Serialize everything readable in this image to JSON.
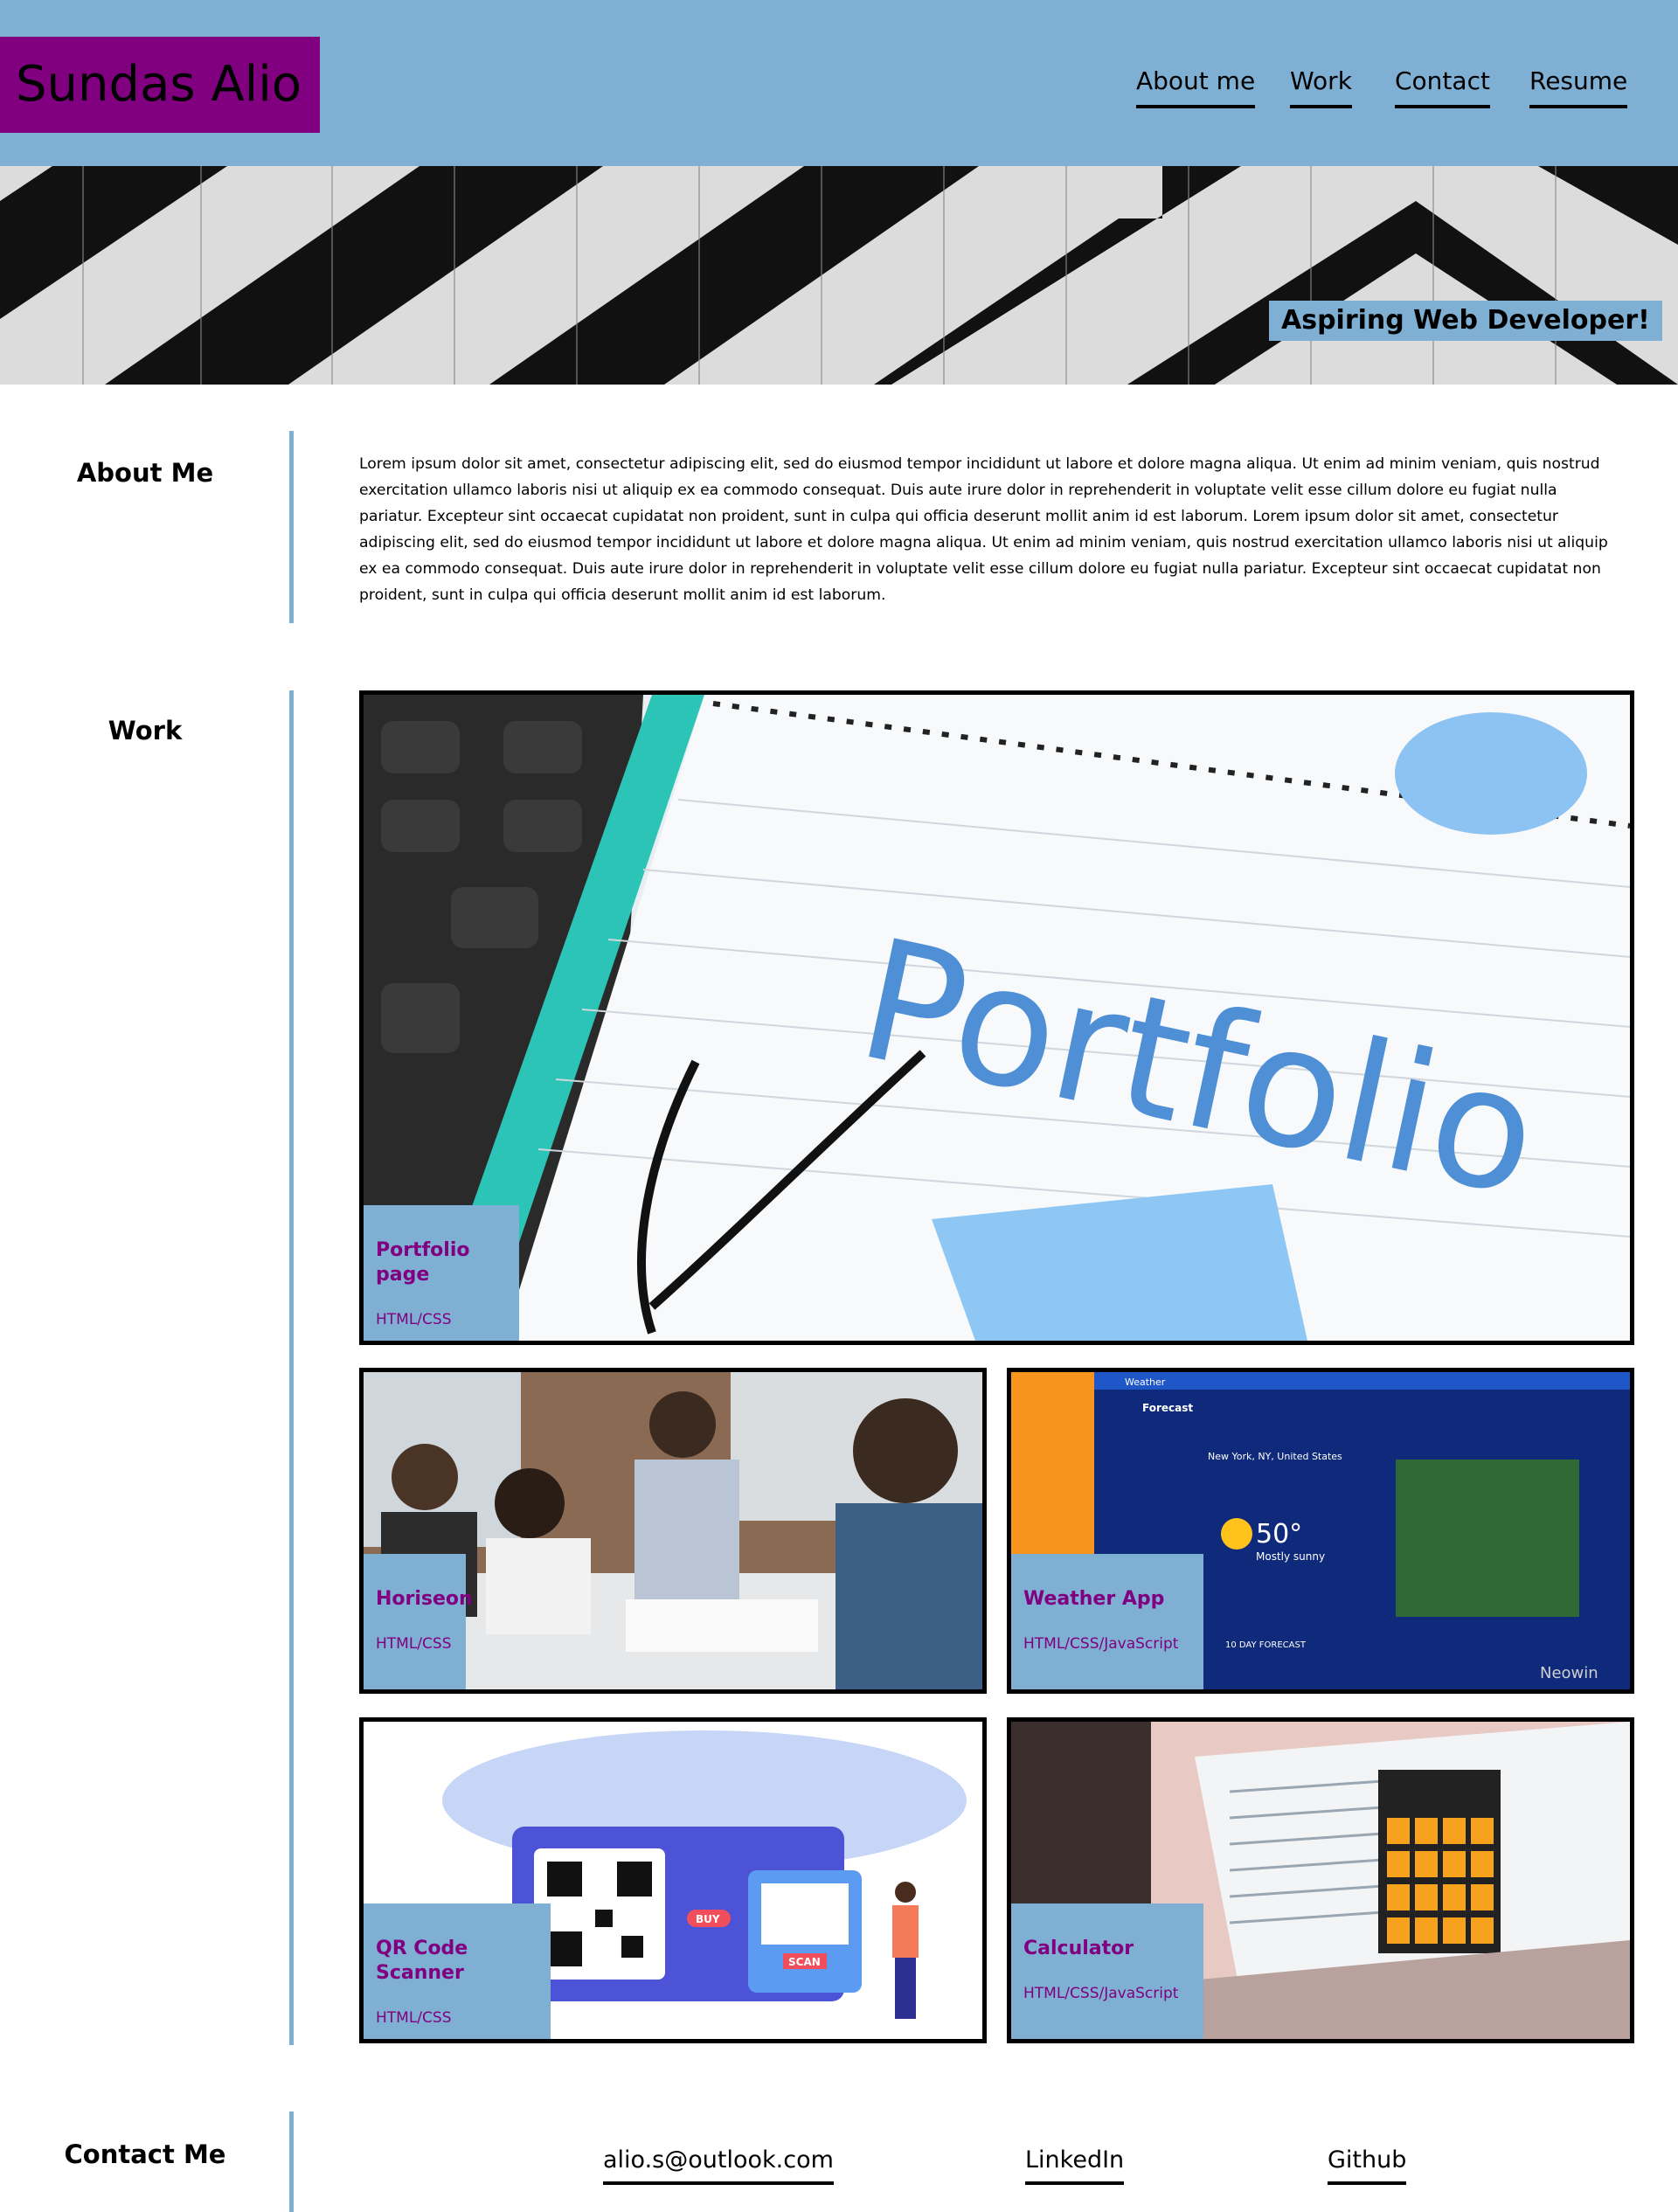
{
  "header": {
    "logo": "Sundas Alio",
    "nav": [
      "About me",
      "Work",
      "Contact",
      "Resume"
    ]
  },
  "hero": {
    "tagline": "Aspiring Web Developer!"
  },
  "about": {
    "heading": "About Me",
    "text": "Lorem ipsum dolor sit amet, consectetur adipiscing elit, sed do eiusmod tempor incididunt ut labore et dolore magna aliqua. Ut enim ad minim veniam, quis nostrud exercitation ullamco laboris nisi ut aliquip ex ea commodo consequat. Duis aute irure dolor in reprehenderit in voluptate velit esse cillum dolore eu fugiat nulla pariatur. Excepteur sint occaecat cupidatat non proident, sunt in culpa qui officia deserunt mollit anim id est laborum. Lorem ipsum dolor sit amet, consectetur adipiscing elit, sed do eiusmod tempor incididunt ut labore et dolore magna aliqua. Ut enim ad minim veniam, quis nostrud exercitation ullamco laboris nisi ut aliquip ex ea commodo consequat. Duis aute irure dolor in reprehenderit in voluptate velit esse cillum dolore eu fugiat nulla pariatur. Excepteur sint occaecat cupidatat non proident, sunt in culpa qui officia deserunt mollit anim id est laborum."
  },
  "work": {
    "heading": "Work",
    "projects": [
      {
        "title": "Portfolio page",
        "tech": "HTML/CSS",
        "image_text": "Portfolio"
      },
      {
        "title": "Horiseon",
        "tech": "HTML/CSS"
      },
      {
        "title": "Weather App",
        "tech": "HTML/CSS/JavaScript",
        "image_text": {
          "app": "Weather",
          "view": "Forecast",
          "location": "New York, NY, United States",
          "temp": "50°",
          "condition": "Mostly sunny",
          "section": "10 DAY FORECAST",
          "watermark": "Neowin"
        }
      },
      {
        "title": "QR Code Scanner",
        "tech": "HTML/CSS",
        "image_text": {
          "buy": "BUY",
          "scan": "SCAN"
        }
      },
      {
        "title": "Calculator",
        "tech": "HTML/CSS/JavaScript"
      }
    ]
  },
  "contact": {
    "heading": "Contact Me",
    "links": [
      "alio.s@outlook.com",
      "LinkedIn",
      "Github"
    ]
  },
  "colors": {
    "header_bg": "#7fb0d3",
    "logo_bg": "#800080",
    "accent_text": "#800080"
  }
}
